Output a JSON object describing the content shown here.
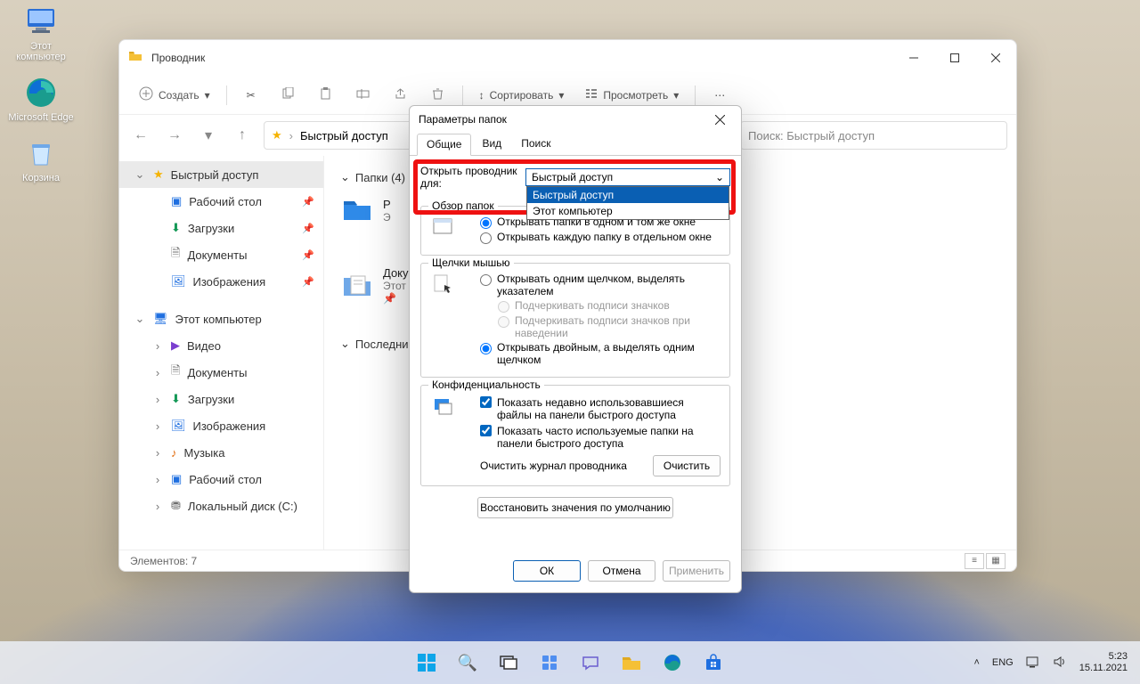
{
  "desktop": {
    "iconThisPC": "Этот компьютер",
    "iconEdge": "Microsoft Edge",
    "iconRecycle": "Корзина"
  },
  "explorer": {
    "title": "Проводник",
    "newBtn": "Создать",
    "sortBtn": "Сортировать",
    "viewBtn": "Просмотреть",
    "breadcrumb": "Быстрый доступ",
    "searchPlaceholder": "Поиск: Быстрый доступ",
    "status": "Элементов: 7",
    "sections": {
      "folders": "Папки (4)",
      "recent": "Последние"
    },
    "sidebar": {
      "quick": "Быстрый доступ",
      "items1": [
        "Рабочий стол",
        "Загрузки",
        "Документы",
        "Изображения"
      ],
      "thispc": "Этот компьютер",
      "items2": [
        "Видео",
        "Документы",
        "Загрузки",
        "Изображения",
        "Музыка",
        "Рабочий стол",
        "Локальный диск (C:)"
      ]
    },
    "cards": {
      "docs": {
        "t1": "Документы",
        "t2": "Этот компьютер"
      }
    }
  },
  "dialog": {
    "title": "Параметры папок",
    "tabs": [
      "Общие",
      "Вид",
      "Поиск"
    ],
    "openFor": "Открыть проводник для:",
    "comboValue": "Быстрый доступ",
    "comboOptions": [
      "Быстрый доступ",
      "Этот компьютер"
    ],
    "browse": "Обзор папок",
    "browseOpt1": "Открывать папки в одном и том же окне",
    "browseOpt2": "Открывать каждую папку в отдельном окне",
    "clicks": "Щелчки мышью",
    "clickOpt1": "Открывать одним щелчком, выделять указателем",
    "clickSub1": "Подчеркивать подписи значков",
    "clickSub2": "Подчеркивать подписи значков при наведении",
    "clickOpt2": "Открывать двойным, а выделять одним щелчком",
    "privacy": "Конфиденциальность",
    "privChk1": "Показать недавно использовавшиеся файлы на панели быстрого доступа",
    "privChk2": "Показать часто используемые папки на панели быстрого доступа",
    "clearText": "Очистить журнал проводника",
    "clearBtn": "Очистить",
    "restore": "Восстановить значения по умолчанию",
    "ok": "ОК",
    "cancel": "Отмена",
    "apply": "Применить"
  },
  "taskbar": {
    "lang": "ENG",
    "time": "5:23",
    "date": "15.11.2021"
  }
}
